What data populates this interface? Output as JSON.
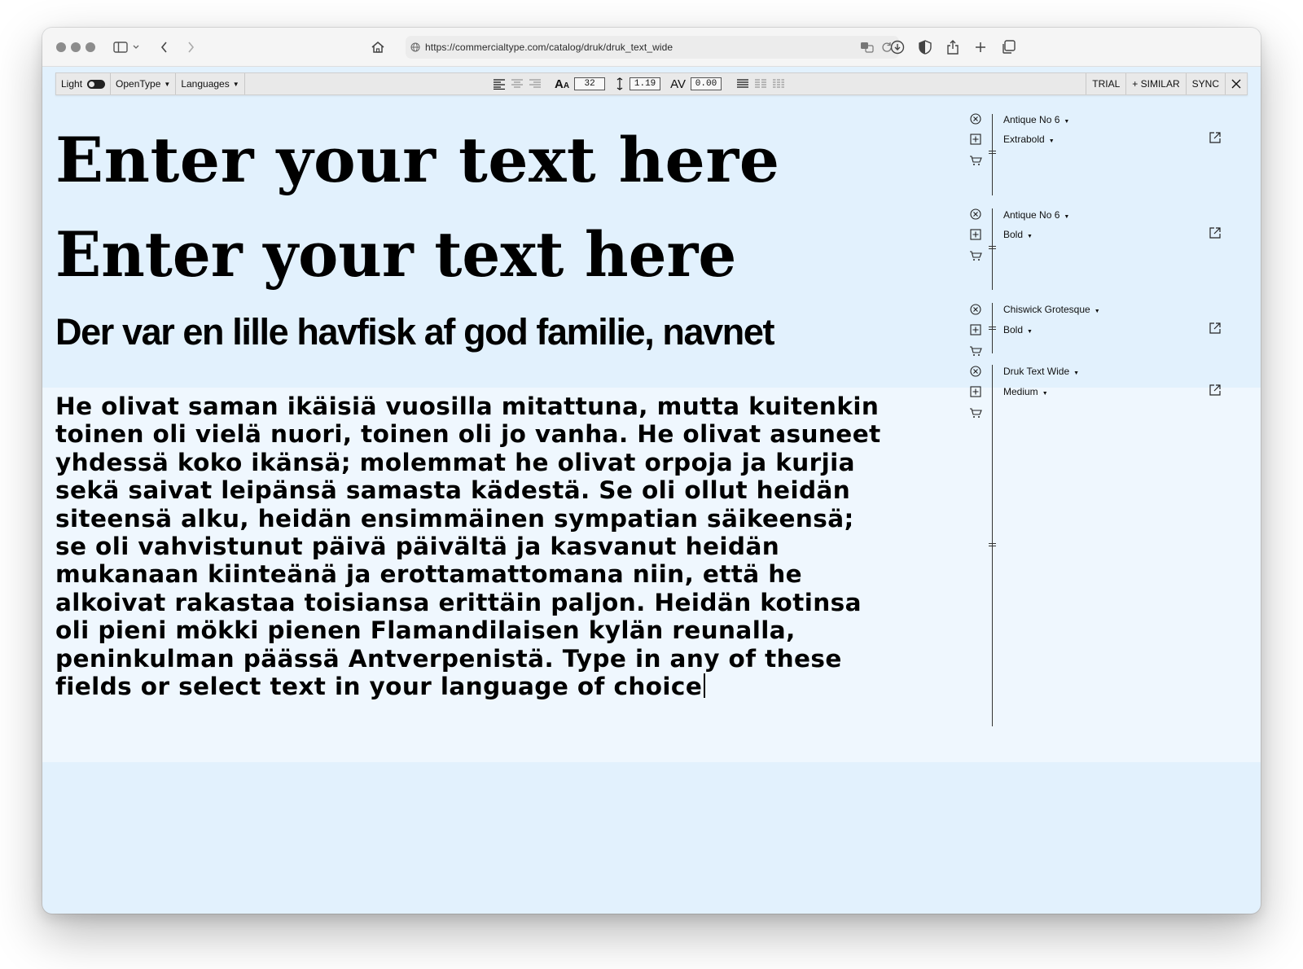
{
  "browser": {
    "url": "https://commercialtype.com/catalog/druk/druk_text_wide"
  },
  "toolbar": {
    "light_label": "Light",
    "opentype_label": "OpenType",
    "languages_label": "Languages",
    "size_value": "32",
    "leading_value": "1.19",
    "tracking_value": "0.00",
    "trial_label": "TRIAL",
    "similar_label": "+ SIMILAR",
    "sync_label": "SYNC"
  },
  "samples": {
    "line1": "Enter your text here",
    "line2": "Enter your text here",
    "line3": "Der var en lille havfisk af god familie, navnet",
    "paragraph": "He olivat saman ikäisiä vuosilla mitattuna, mutta kuitenkin\ntoinen oli vielä nuori, toinen oli jo vanha. He olivat asuneet\nyhdessä koko ikänsä; molemmat he olivat orpoja ja kurjia\nsekä saivat leipänsä samasta kädestä. Se oli ollut heidän\nsiteensä alku, heidän ensimmäinen sympatian säikeensä;\nse oli vahvistunut päivä päivältä ja kasvanut heidän\nmukanaan kiinteänä ja erottamattomana niin, että he\nalkoivat rakastaa toisiansa erittäin paljon. Heidän kotinsa\noli pieni mökki pienen Flamandilaisen kylän reunalla,\npeninkulman päässä Antverpenistä. Type in any of these\nfields or select text in your language of choice"
  },
  "side_panel": {
    "entries": [
      {
        "family": "Antique No 6",
        "style": "Extrabold"
      },
      {
        "family": "Antique No 6",
        "style": "Bold"
      },
      {
        "family": "Chiswick Grotesque",
        "style": "Bold"
      },
      {
        "family": "Druk Text Wide",
        "style": "Medium"
      }
    ],
    "icons": [
      "remove-icon",
      "add-icon",
      "cart-icon",
      "external-link-icon"
    ]
  }
}
